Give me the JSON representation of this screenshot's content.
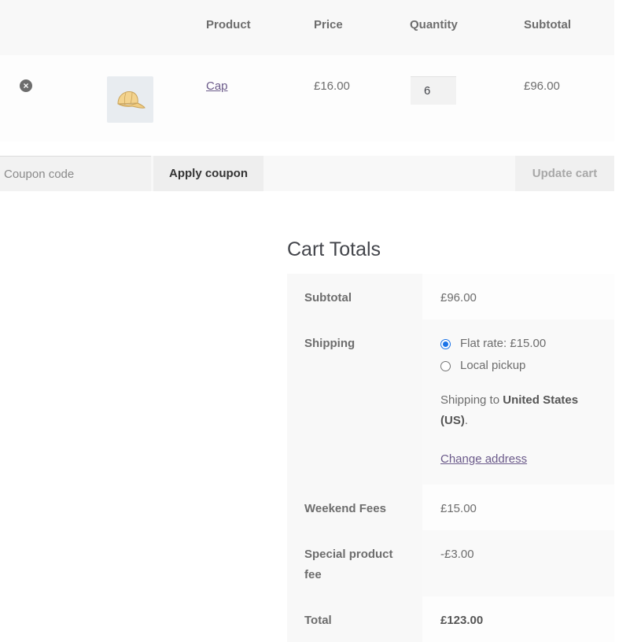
{
  "cart_table": {
    "headers": {
      "product": "Product",
      "price": "Price",
      "quantity": "Quantity",
      "subtotal": "Subtotal"
    },
    "items": [
      {
        "remove_icon": "×",
        "product_name": "Cap",
        "price": "£16.00",
        "quantity": "6",
        "subtotal": "£96.00"
      }
    ]
  },
  "actions": {
    "coupon_placeholder": "Coupon code",
    "apply_coupon_label": "Apply coupon",
    "update_cart_label": "Update cart"
  },
  "cart_totals": {
    "title": "Cart Totals",
    "subtotal_label": "Subtotal",
    "subtotal_value": "£96.00",
    "shipping_label": "Shipping",
    "shipping_options": [
      {
        "label": "Flat rate: £15.00",
        "selected": true
      },
      {
        "label": "Local pickup",
        "selected": false
      }
    ],
    "shipping_to_prefix": "Shipping to",
    "shipping_destination": "United States",
    "shipping_destination_suffix": "(US)",
    "shipping_to_end": ".",
    "change_address_label": "Change address",
    "weekend_fees_label": "Weekend Fees",
    "weekend_fees_value": "£15.00",
    "special_fee_label_line1": "Special product",
    "special_fee_label_line2": "fee",
    "special_fee_value": "-£3.00",
    "total_label": "Total",
    "total_value": "£123.00"
  }
}
